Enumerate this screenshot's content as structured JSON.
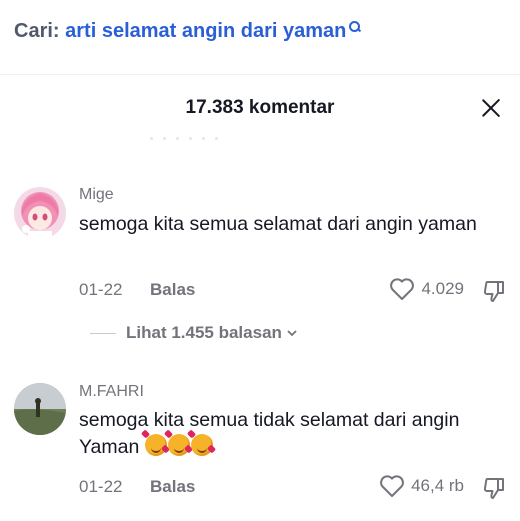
{
  "search": {
    "prefix": "Cari:",
    "query": "arti selamat angin dari yaman"
  },
  "sheet": {
    "title": "17.383 komentar"
  },
  "comments": [
    {
      "username": "Mige",
      "text": "semoga kita semua selamat dari angin yaman",
      "date": "01-22",
      "reply_label": "Balas",
      "likes": "4.029",
      "view_replies": "Lihat 1.455 balasan"
    },
    {
      "username": "M.FAHRI",
      "text": "semoga kita semua tidak selamat dari angin Yaman",
      "emoji": [
        "smiling-face-with-hearts",
        "smiling-face-with-hearts",
        "smiling-face-with-hearts"
      ],
      "date": "01-22",
      "reply_label": "Balas",
      "likes": "46,4 rb"
    }
  ],
  "icons": {
    "search": "search-icon",
    "close": "close-icon",
    "like": "heart-outline-icon",
    "dislike": "thumbs-down-icon",
    "chevron": "chevron-down-icon"
  },
  "colors": {
    "link": "#2a5fd8",
    "text": "#161823",
    "muted": "#73747b"
  }
}
